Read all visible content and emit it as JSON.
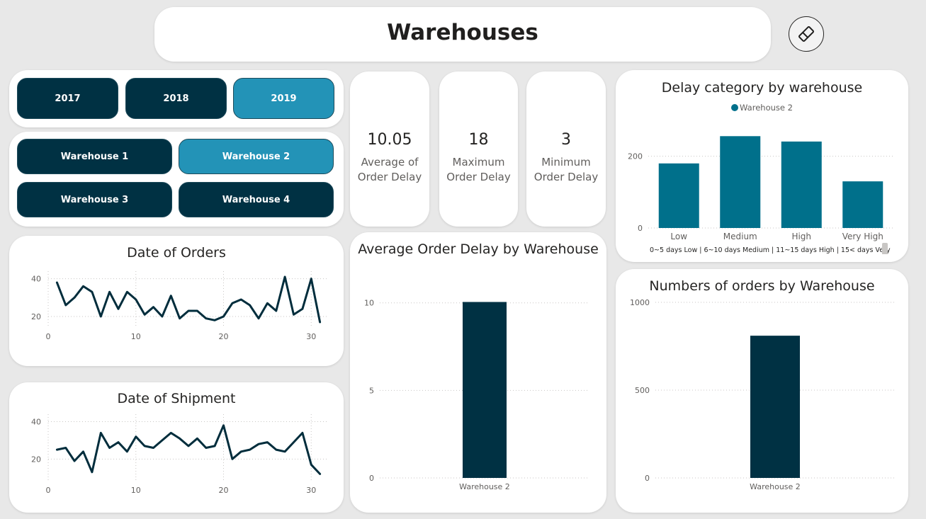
{
  "header": {
    "title": "Warehouses",
    "clear_icon": "eraser-icon"
  },
  "year_slicer": {
    "items": [
      {
        "label": "2017",
        "selected": false
      },
      {
        "label": "2018",
        "selected": false
      },
      {
        "label": "2019",
        "selected": true
      }
    ]
  },
  "warehouse_slicer": {
    "items": [
      {
        "label": "Warehouse 1",
        "selected": false
      },
      {
        "label": "Warehouse 2",
        "selected": true
      },
      {
        "label": "Warehouse 3",
        "selected": false
      },
      {
        "label": "Warehouse 4",
        "selected": false
      }
    ]
  },
  "kpis": [
    {
      "value": "10.05",
      "label": "Average of Order Delay"
    },
    {
      "value": "18",
      "label": "Maximum Order Delay"
    },
    {
      "value": "3",
      "label": "Minimum Order Delay"
    }
  ],
  "colors": {
    "dark": "#003143",
    "accent": "#2393b7",
    "bar_teal": "#00708b",
    "line": "#002d3c",
    "background": "#e8e8e8",
    "card": "#ffffff"
  },
  "chart_data": [
    {
      "id": "delay_category",
      "type": "bar",
      "title": "Delay category by warehouse",
      "legend": [
        "Warehouse 2"
      ],
      "legend_position": "top-center",
      "categories": [
        "Low",
        "Medium",
        "High",
        "Very High"
      ],
      "series": [
        {
          "name": "Warehouse 2",
          "values": [
            180,
            256,
            241,
            130
          ]
        }
      ],
      "ylim": [
        0,
        300
      ],
      "yticks": [
        0,
        200
      ],
      "footnote": "0~5 days Low | 6~10 days Medium | 11~15 days High | 15< days Very",
      "grid": true
    },
    {
      "id": "date_of_orders",
      "type": "line",
      "title": "Date of Orders",
      "x": [
        1,
        2,
        3,
        4,
        5,
        6,
        7,
        8,
        9,
        10,
        11,
        12,
        13,
        14,
        15,
        16,
        17,
        18,
        19,
        20,
        21,
        22,
        23,
        24,
        25,
        26,
        27,
        28,
        29,
        30,
        31
      ],
      "values": [
        38,
        26,
        30,
        36,
        33,
        20,
        33,
        24,
        33,
        29,
        21,
        25,
        20,
        31,
        19,
        23,
        23,
        19,
        18,
        20,
        27,
        29,
        26,
        19,
        27,
        23,
        41,
        21,
        24,
        40,
        17
      ],
      "xticks": [
        0,
        10,
        20,
        30
      ],
      "yticks": [
        20,
        40
      ],
      "xlim": [
        0,
        32
      ],
      "ylim": [
        14,
        44
      ],
      "grid": true
    },
    {
      "id": "date_of_shipment",
      "type": "line",
      "title": "Date of Shipment",
      "x": [
        1,
        2,
        3,
        4,
        5,
        6,
        7,
        8,
        9,
        10,
        11,
        12,
        13,
        14,
        15,
        16,
        17,
        18,
        19,
        20,
        21,
        22,
        23,
        24,
        25,
        26,
        27,
        28,
        29,
        30,
        31
      ],
      "values": [
        25,
        26,
        19,
        24,
        13,
        34,
        26,
        29,
        24,
        32,
        27,
        26,
        30,
        34,
        31,
        27,
        31,
        26,
        27,
        38,
        20,
        24,
        25,
        28,
        29,
        25,
        24,
        29,
        34,
        17,
        12
      ],
      "xticks": [
        0,
        10,
        20,
        30
      ],
      "yticks": [
        20,
        40
      ],
      "xlim": [
        0,
        32
      ],
      "ylim": [
        8,
        44
      ],
      "grid": true
    },
    {
      "id": "avg_order_delay",
      "type": "bar",
      "title": "Average Order Delay by Warehouse",
      "categories": [
        "Warehouse 2"
      ],
      "values": [
        10.05
      ],
      "ylim": [
        0,
        11
      ],
      "yticks": [
        0,
        5,
        10
      ],
      "grid": true
    },
    {
      "id": "orders_by_warehouse",
      "type": "bar",
      "title": "Numbers of orders by Warehouse",
      "categories": [
        "Warehouse 2"
      ],
      "values": [
        810
      ],
      "ylim": [
        0,
        1000
      ],
      "yticks": [
        0,
        500,
        1000
      ],
      "grid": true
    }
  ]
}
